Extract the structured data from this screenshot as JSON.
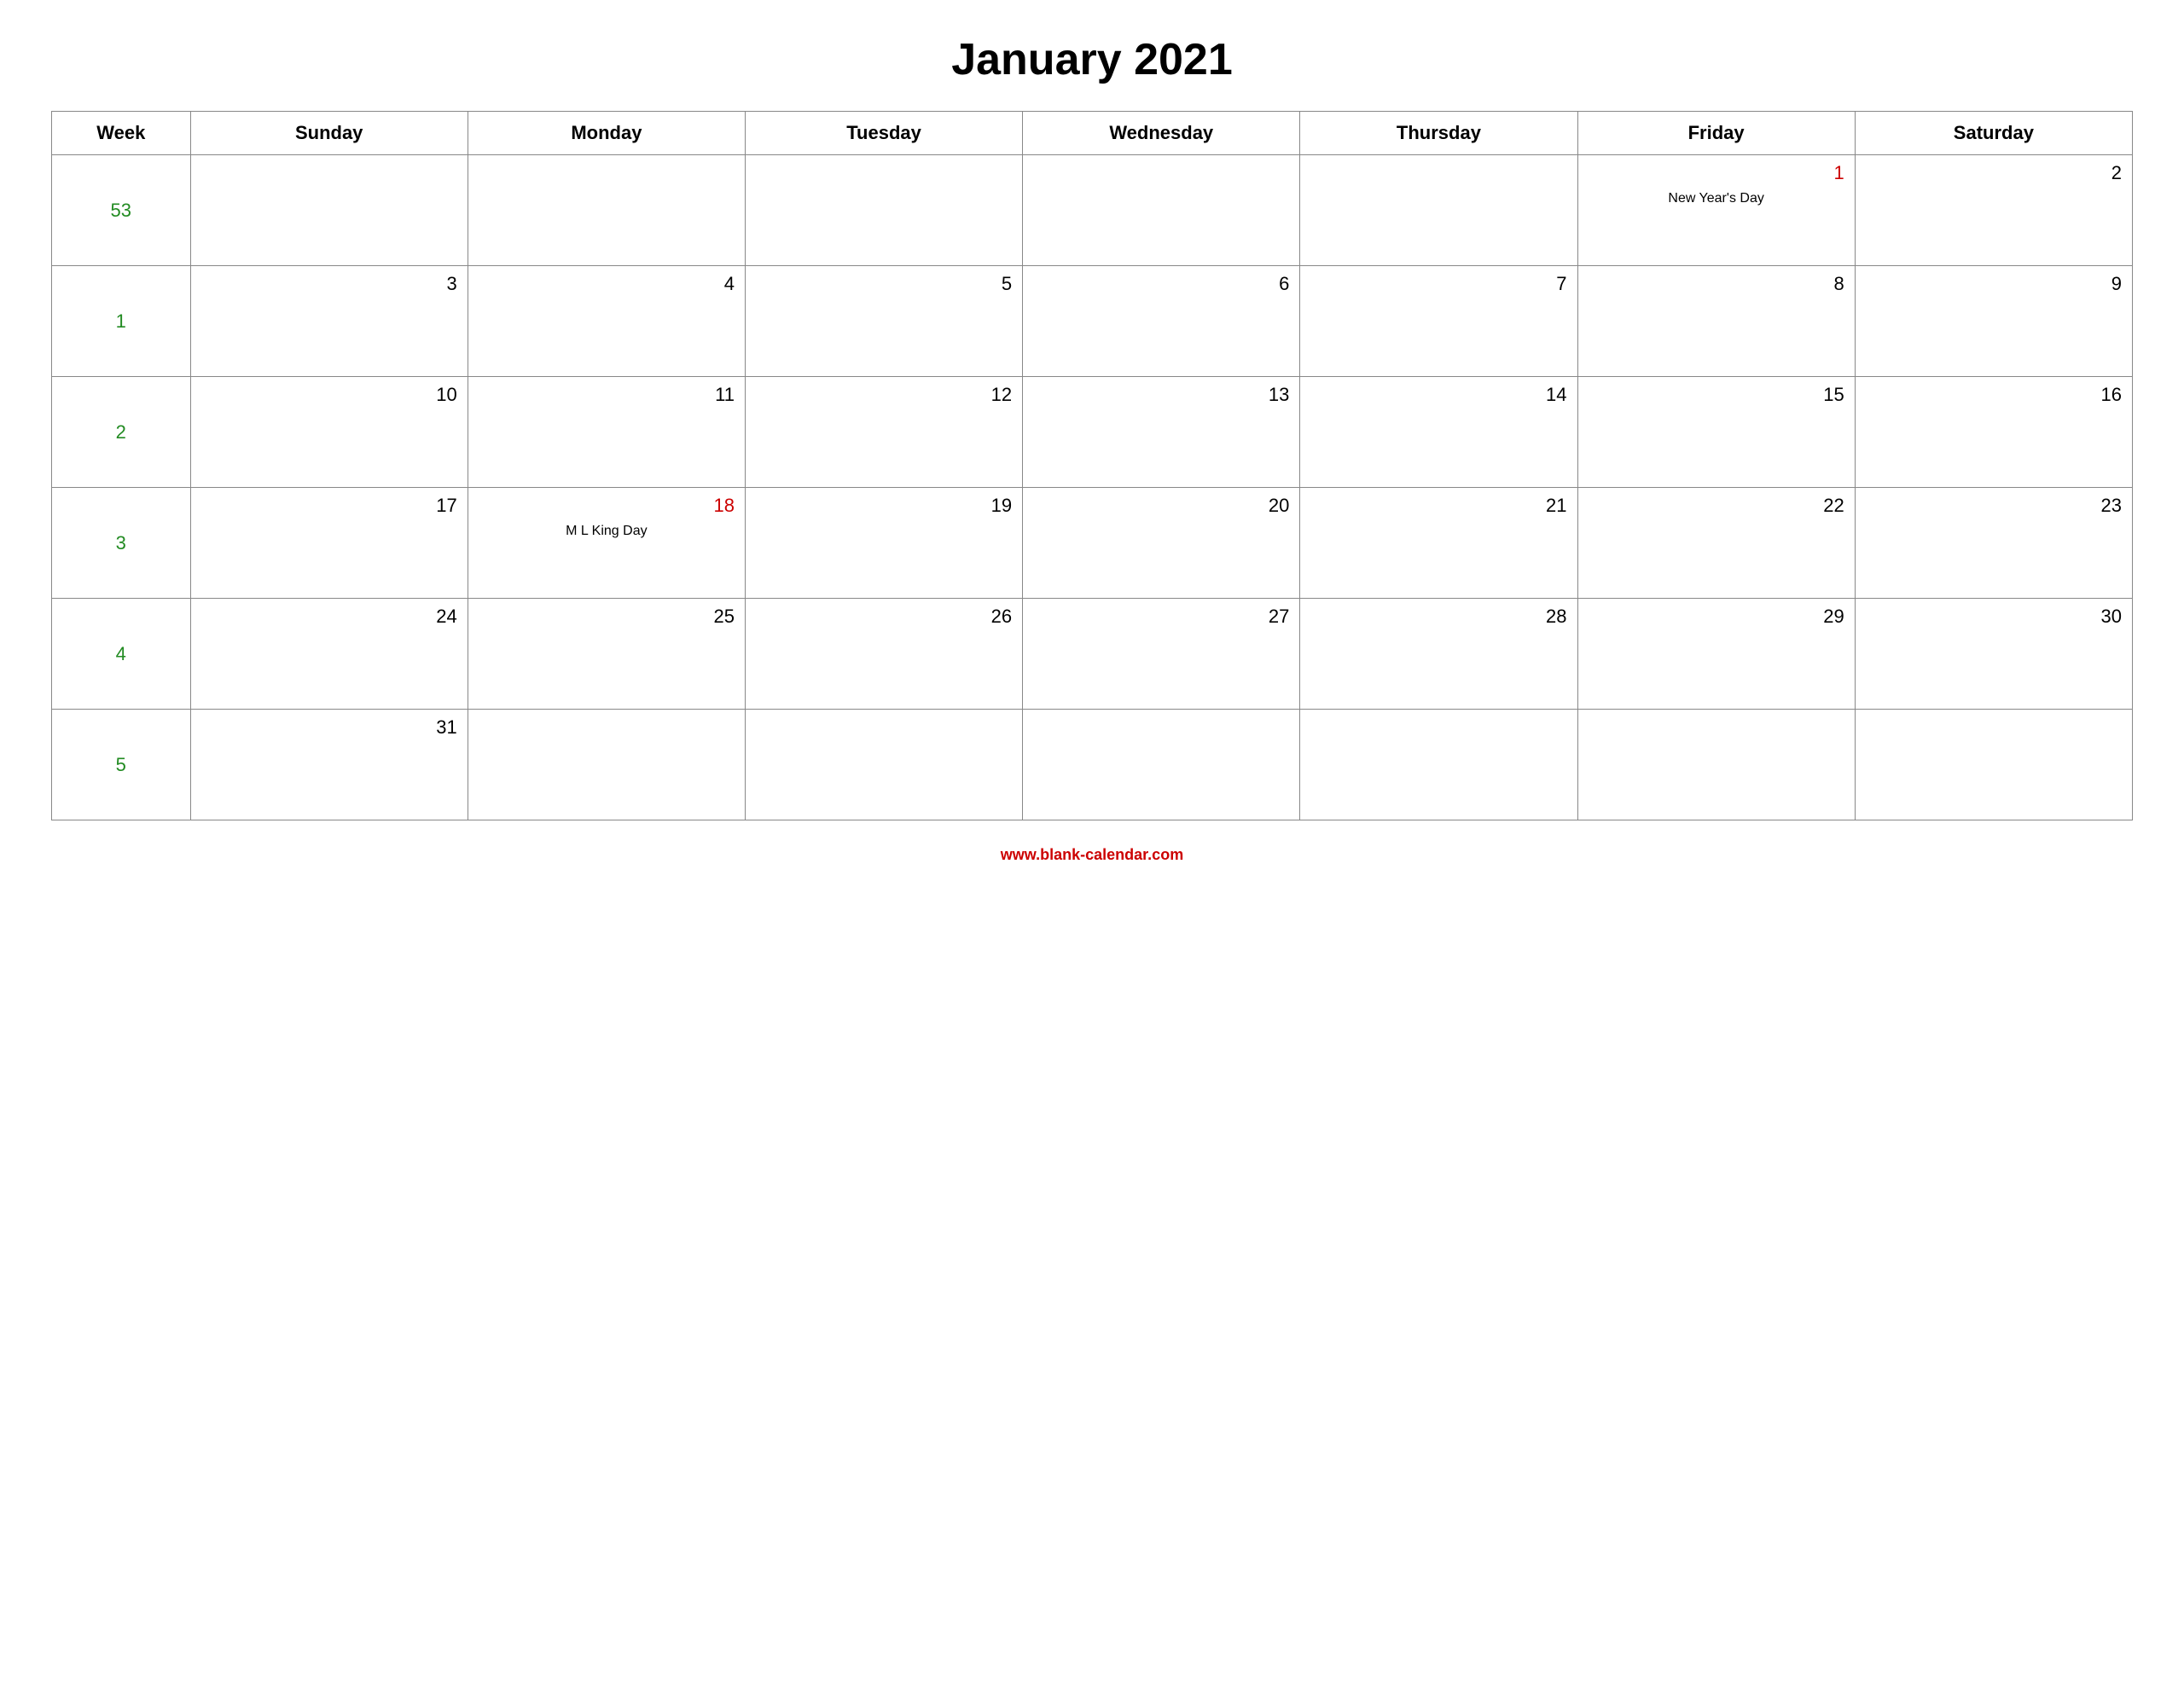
{
  "title": "January 2021",
  "columns": [
    "Week",
    "Sunday",
    "Monday",
    "Tuesday",
    "Wednesday",
    "Thursday",
    "Friday",
    "Saturday"
  ],
  "weeks": [
    {
      "week_num": "53",
      "days": [
        {
          "num": "",
          "holiday": ""
        },
        {
          "num": "",
          "holiday": ""
        },
        {
          "num": "",
          "holiday": ""
        },
        {
          "num": "",
          "holiday": ""
        },
        {
          "num": "",
          "holiday": ""
        },
        {
          "num": "1",
          "holiday": "New  Year's  Day",
          "red": true
        },
        {
          "num": "2",
          "holiday": ""
        }
      ]
    },
    {
      "week_num": "1",
      "days": [
        {
          "num": "3",
          "holiday": ""
        },
        {
          "num": "4",
          "holiday": ""
        },
        {
          "num": "5",
          "holiday": ""
        },
        {
          "num": "6",
          "holiday": ""
        },
        {
          "num": "7",
          "holiday": ""
        },
        {
          "num": "8",
          "holiday": ""
        },
        {
          "num": "9",
          "holiday": ""
        }
      ]
    },
    {
      "week_num": "2",
      "days": [
        {
          "num": "10",
          "holiday": ""
        },
        {
          "num": "11",
          "holiday": ""
        },
        {
          "num": "12",
          "holiday": ""
        },
        {
          "num": "13",
          "holiday": ""
        },
        {
          "num": "14",
          "holiday": ""
        },
        {
          "num": "15",
          "holiday": ""
        },
        {
          "num": "16",
          "holiday": ""
        }
      ]
    },
    {
      "week_num": "3",
      "days": [
        {
          "num": "17",
          "holiday": ""
        },
        {
          "num": "18",
          "holiday": "M  L  King  Day",
          "red": true
        },
        {
          "num": "19",
          "holiday": ""
        },
        {
          "num": "20",
          "holiday": ""
        },
        {
          "num": "21",
          "holiday": ""
        },
        {
          "num": "22",
          "holiday": ""
        },
        {
          "num": "23",
          "holiday": ""
        }
      ]
    },
    {
      "week_num": "4",
      "days": [
        {
          "num": "24",
          "holiday": ""
        },
        {
          "num": "25",
          "holiday": ""
        },
        {
          "num": "26",
          "holiday": ""
        },
        {
          "num": "27",
          "holiday": ""
        },
        {
          "num": "28",
          "holiday": ""
        },
        {
          "num": "29",
          "holiday": ""
        },
        {
          "num": "30",
          "holiday": ""
        }
      ]
    },
    {
      "week_num": "5",
      "days": [
        {
          "num": "31",
          "holiday": ""
        },
        {
          "num": "",
          "holiday": ""
        },
        {
          "num": "",
          "holiday": ""
        },
        {
          "num": "",
          "holiday": ""
        },
        {
          "num": "",
          "holiday": ""
        },
        {
          "num": "",
          "holiday": ""
        },
        {
          "num": "",
          "holiday": ""
        }
      ]
    }
  ],
  "footer": {
    "url": "www.blank-calendar.com"
  }
}
